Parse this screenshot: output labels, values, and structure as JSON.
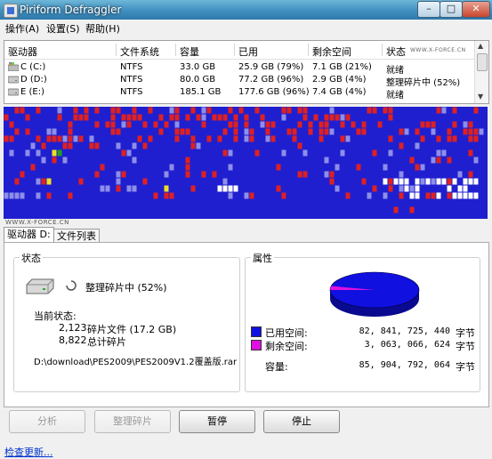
{
  "window": {
    "title": "Piriform Defraggler",
    "min_label": "–",
    "max_label": "□",
    "close_label": "✕"
  },
  "menu": [
    "操作(A)",
    "设置(S)",
    "帮助(H)"
  ],
  "drive_list": {
    "columns": [
      "驱动器",
      "文件系统",
      "容量",
      "已用",
      "剩余空间",
      "状态"
    ],
    "watermark": "WWW.X-FORCE.CN",
    "rows": [
      {
        "drive": "C (C:)",
        "fs": "NTFS",
        "capacity": "33.0 GB",
        "used": "25.9 GB (79%)",
        "free": "7.1 GB (21%)",
        "status": "就绪"
      },
      {
        "drive": "D (D:)",
        "fs": "NTFS",
        "capacity": "80.0 GB",
        "used": "77.2 GB (96%)",
        "free": "2.9 GB (4%)",
        "status": "整理碎片中 (52%)"
      },
      {
        "drive": "E (E:)",
        "fs": "NTFS",
        "capacity": "185.1 GB",
        "used": "177.6 GB (96%)",
        "free": "7.4 GB (4%)",
        "status": "就绪"
      }
    ]
  },
  "block_map": {
    "legend_colors": {
      "free": "#ffffff",
      "used": "#1f1fd0",
      "fragmented": "#e02020",
      "light": "#8e8ee8",
      "system": "#f0e020",
      "green": "#20a020"
    }
  },
  "map_watermark": "WWW.X-FORCE.CN",
  "tabs": [
    "驱动器 D:",
    "文件列表"
  ],
  "status_group": {
    "title": "状态",
    "progress_text": "整理碎片中 (52%)",
    "current_label": "当前状态:",
    "frag_files_count": "2,123",
    "frag_files_label": "碎片文件 (17.2 GB)",
    "total_frags_count": "8,822",
    "total_frags_label": "总计碎片",
    "current_file": "D:\\download\\PES2009\\PES2009V1.2覆盖版.rar"
  },
  "properties_group": {
    "title": "属性",
    "used_label": "已用空间:",
    "used_value": "82, 841, 725, 440",
    "free_label": "剩余空间:",
    "free_value": "3, 063, 066, 624",
    "capacity_label": "容量:",
    "capacity_value": "85, 904, 792, 064",
    "unit": "字节",
    "used_color": "#1010e0",
    "free_color": "#e010e0",
    "used_fraction": 0.964
  },
  "buttons": {
    "analyze": "分析",
    "defrag": "整理碎片",
    "pause": "暂停",
    "stop": "停止"
  },
  "update_link": "检查更新..."
}
